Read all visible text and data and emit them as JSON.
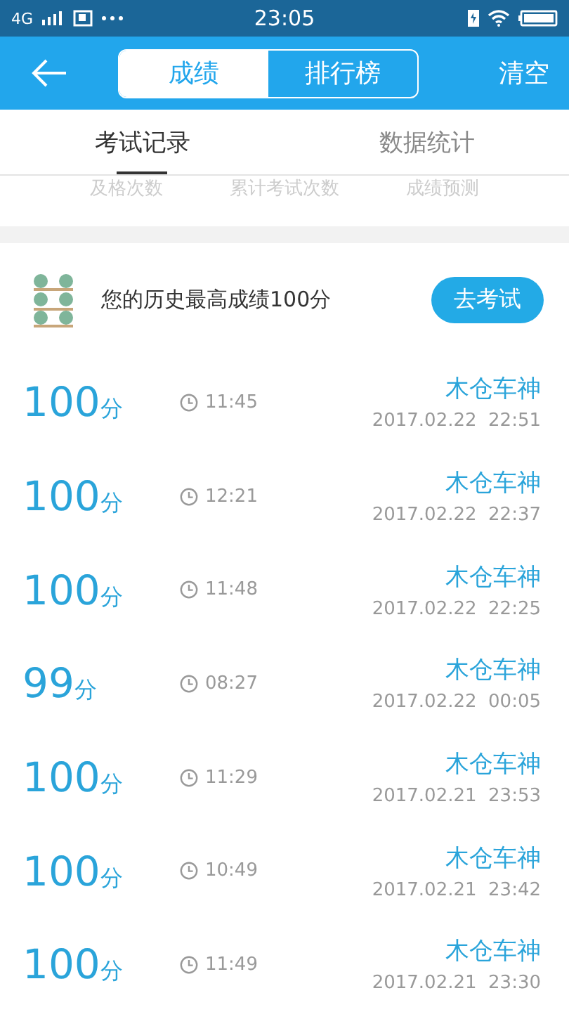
{
  "status_bar": {
    "network": "4G",
    "time": "23:05"
  },
  "header": {
    "segments": [
      {
        "label": "成绩",
        "selected": true
      },
      {
        "label": "排行榜",
        "selected": false
      }
    ],
    "action": "清空"
  },
  "tabs": [
    {
      "label": "考试记录",
      "selected": true
    },
    {
      "label": "数据统计",
      "selected": false
    }
  ],
  "stats_labels": [
    "及格次数",
    "累计考试次数",
    "成绩预测"
  ],
  "best": {
    "text": "您的历史最高成绩100分",
    "button": "去考试"
  },
  "records": [
    {
      "score": "100",
      "unit": "分",
      "duration": "11:45",
      "name": "木仓车神",
      "datetime": "2017.02.22  22:51"
    },
    {
      "score": "100",
      "unit": "分",
      "duration": "12:21",
      "name": "木仓车神",
      "datetime": "2017.02.22  22:37"
    },
    {
      "score": "100",
      "unit": "分",
      "duration": "11:48",
      "name": "木仓车神",
      "datetime": "2017.02.22  22:25"
    },
    {
      "score": "99",
      "unit": "分",
      "duration": "08:27",
      "name": "木仓车神",
      "datetime": "2017.02.22  00:05"
    },
    {
      "score": "100",
      "unit": "分",
      "duration": "11:29",
      "name": "木仓车神",
      "datetime": "2017.02.21  23:53"
    },
    {
      "score": "100",
      "unit": "分",
      "duration": "10:49",
      "name": "木仓车神",
      "datetime": "2017.02.21  23:42"
    },
    {
      "score": "100",
      "unit": "分",
      "duration": "11:49",
      "name": "木仓车神",
      "datetime": "2017.02.21  23:30"
    }
  ]
}
